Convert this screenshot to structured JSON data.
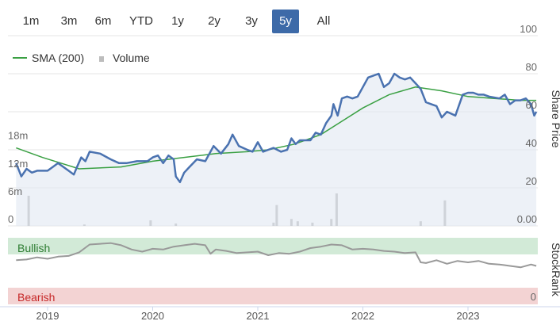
{
  "range_buttons": [
    {
      "label": "1m"
    },
    {
      "label": "3m"
    },
    {
      "label": "6m"
    },
    {
      "label": "YTD"
    },
    {
      "label": "1y"
    },
    {
      "label": "2y"
    },
    {
      "label": "3y"
    },
    {
      "label": "5y",
      "active": true
    },
    {
      "label": "All"
    }
  ],
  "legend": {
    "sma_label": "SMA (200)",
    "volume_label": "Volume"
  },
  "colors": {
    "price": "#4a72b0",
    "sma": "#3aa043",
    "volume": "#bdbdbd",
    "bullish_bg": "#d2ead7",
    "bearish_bg": "#f3d3d3",
    "bullish_text": "#2e7d32",
    "bearish_text": "#c62828",
    "stockrank": "#999999",
    "active_button": "#3d6aa8"
  },
  "chart_data": {
    "type": "line",
    "x_ticks": [
      "2019",
      "2020",
      "2021",
      "2022",
      "2023"
    ],
    "price_axis": {
      "title": "Share Price",
      "ticks": [
        "20",
        "40",
        "60",
        "80",
        "100"
      ],
      "range": [
        0,
        100
      ]
    },
    "volume_axis": {
      "ticks": [
        "0",
        "6m",
        "12m",
        "18m"
      ],
      "range": [
        0,
        18
      ]
    },
    "volume_right_label": "0.00",
    "stockrank_axis": {
      "title": "StockRank",
      "bottom_tick": "0"
    },
    "bands": {
      "bullish": "Bullish",
      "bearish": "Bearish"
    },
    "series": [
      {
        "name": "SMA (200)",
        "x": [
          2018.7,
          2018.95,
          2019.3,
          2019.7,
          2020.0,
          2020.3,
          2020.6,
          2020.9,
          2021.1,
          2021.35,
          2021.6,
          2021.8,
          2022.0,
          2022.25,
          2022.5,
          2022.75,
          2023.0,
          2023.25,
          2023.5,
          2023.65
        ],
        "values": [
          41,
          36,
          30,
          31,
          34,
          36,
          38,
          39,
          40,
          43,
          48,
          55,
          62,
          69,
          73,
          71,
          68,
          67,
          66,
          66
        ]
      },
      {
        "name": "Price",
        "x": [
          2018.7,
          2018.75,
          2018.8,
          2018.85,
          2018.9,
          2019.0,
          2019.05,
          2019.1,
          2019.15,
          2019.2,
          2019.25,
          2019.28,
          2019.32,
          2019.36,
          2019.4,
          2019.5,
          2019.6,
          2019.68,
          2019.75,
          2019.85,
          2019.95,
          2020.0,
          2020.05,
          2020.1,
          2020.15,
          2020.2,
          2020.22,
          2020.26,
          2020.3,
          2020.35,
          2020.42,
          2020.5,
          2020.58,
          2020.65,
          2020.72,
          2020.76,
          2020.82,
          2020.9,
          2020.95,
          2021.0,
          2021.05,
          2021.1,
          2021.15,
          2021.22,
          2021.28,
          2021.32,
          2021.36,
          2021.4,
          2021.5,
          2021.55,
          2021.6,
          2021.65,
          2021.7,
          2021.72,
          2021.76,
          2021.8,
          2021.85,
          2021.9,
          2021.95,
          2022.0,
          2022.05,
          2022.1,
          2022.15,
          2022.2,
          2022.25,
          2022.3,
          2022.35,
          2022.4,
          2022.45,
          2022.5,
          2022.55,
          2022.6,
          2022.65,
          2022.7,
          2022.75,
          2022.8,
          2022.88,
          2022.95,
          2023.0,
          2023.05,
          2023.1,
          2023.15,
          2023.2,
          2023.3,
          2023.35,
          2023.4,
          2023.45,
          2023.5,
          2023.55,
          2023.6,
          2023.63,
          2023.65
        ],
        "values": [
          33,
          26,
          30,
          28,
          29,
          29,
          31,
          33,
          31,
          29,
          27,
          31,
          36,
          34,
          39,
          38,
          35,
          33,
          33,
          34,
          34,
          36,
          37,
          33,
          37,
          35,
          26,
          23,
          28,
          31,
          35,
          34,
          42,
          38,
          43,
          48,
          42,
          40,
          39,
          44,
          39,
          40,
          41,
          39,
          40,
          46,
          43,
          45,
          45,
          49,
          48,
          54,
          58,
          64,
          58,
          67,
          68,
          67,
          68,
          73,
          78,
          79,
          80,
          73,
          75,
          80,
          78,
          77,
          78,
          75,
          72,
          65,
          64,
          63,
          57,
          60,
          58,
          69,
          70,
          70,
          69,
          69,
          68,
          67,
          69,
          64,
          66,
          66,
          67,
          64,
          58,
          60
        ]
      },
      {
        "name": "StockRank",
        "x": [
          2018.7,
          2018.8,
          2018.9,
          2019.0,
          2019.1,
          2019.2,
          2019.3,
          2019.4,
          2019.5,
          2019.6,
          2019.7,
          2019.8,
          2019.9,
          2020.0,
          2020.1,
          2020.2,
          2020.3,
          2020.4,
          2020.5,
          2020.55,
          2020.6,
          2020.7,
          2020.8,
          2020.9,
          2021.0,
          2021.1,
          2021.2,
          2021.3,
          2021.4,
          2021.5,
          2021.6,
          2021.7,
          2021.8,
          2021.9,
          2022.0,
          2022.1,
          2022.2,
          2022.3,
          2022.4,
          2022.5,
          2022.55,
          2022.6,
          2022.7,
          2022.8,
          2022.9,
          2023.0,
          2023.1,
          2023.2,
          2023.3,
          2023.4,
          2023.5,
          2023.6,
          2023.65
        ],
        "values": [
          63,
          64,
          67,
          65,
          68,
          69,
          74,
          85,
          86,
          87,
          84,
          78,
          75,
          79,
          78,
          82,
          84,
          86,
          84,
          72,
          78,
          76,
          73,
          74,
          75,
          70,
          73,
          72,
          75,
          80,
          82,
          85,
          84,
          78,
          79,
          78,
          76,
          75,
          73,
          74,
          60,
          59,
          63,
          58,
          62,
          60,
          62,
          58,
          57,
          55,
          53,
          57,
          55
        ]
      }
    ],
    "volume_bars": {
      "x": [
        2018.82,
        2019.35,
        2019.98,
        2020.22,
        2021.15,
        2021.18,
        2021.32,
        2021.38,
        2021.52,
        2021.7,
        2021.75,
        2022.55,
        2022.78
      ],
      "values": [
        6.5,
        0.3,
        1.2,
        0.5,
        0.7,
        4.5,
        1.5,
        1,
        0.7,
        1.5,
        7,
        1,
        5.5
      ]
    }
  }
}
